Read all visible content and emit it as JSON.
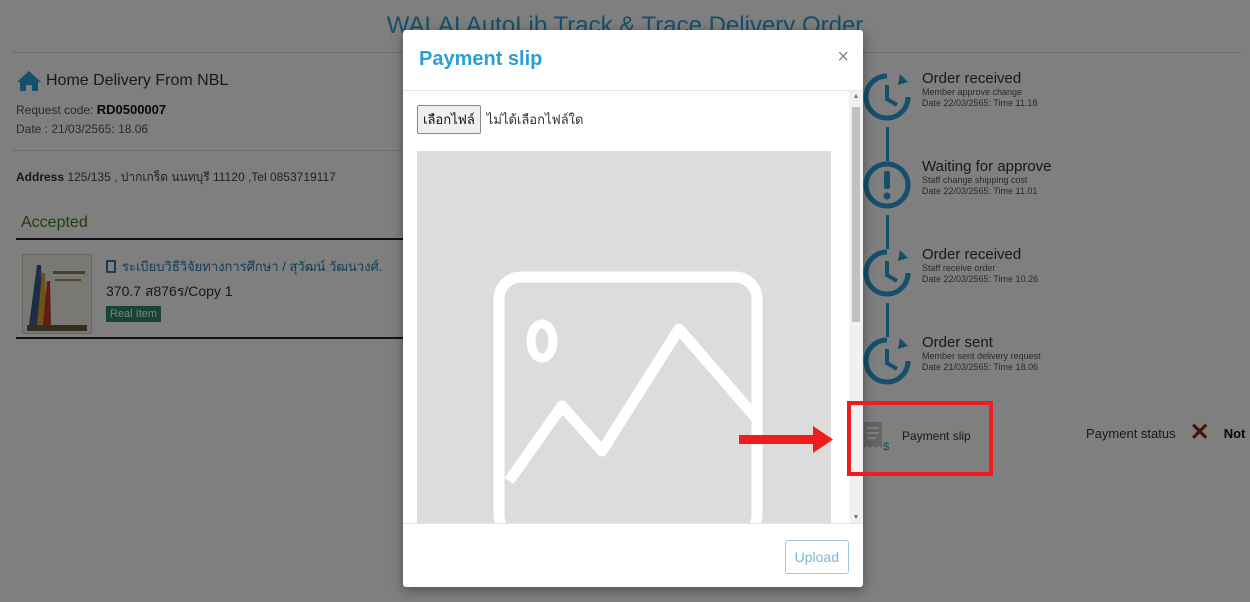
{
  "page": {
    "title": "WALAI AutoLib Track & Trace Delivery Order"
  },
  "order": {
    "home_label": "Home Delivery From NBL",
    "request_code_label": "Request code:",
    "request_code": "RD0500007",
    "date": "Date : 21/03/2565: 18.06",
    "address_label": "Address",
    "address": "125/135 , ปากเกร็ด นนทบุรี 11120 ,Tel 0853719117",
    "status": "Accepted",
    "item": {
      "title": "ระเบียบวิธีวิจัยทางการศึกษา / สุวัฒน์ วัฒนวงศ์.",
      "call_number": "370.7 ส876ร/Copy 1",
      "badge": "Real Item"
    }
  },
  "timeline": [
    {
      "icon": "clock-icon",
      "title": "Order received",
      "line1": "Member approve change",
      "line2": "Date 22/03/2565: Time 11.18"
    },
    {
      "icon": "exclamation-icon",
      "title": "Waiting for approve",
      "line1": "Staff change shipping cost",
      "line2": "Date 22/03/2565: Time 11.01"
    },
    {
      "icon": "clock-icon",
      "title": "Order received",
      "line1": "Staff receive order",
      "line2": "Date 22/03/2565: Time 10.26"
    },
    {
      "icon": "clock-icon",
      "title": "Order sent",
      "line1": "Member sent delivery request",
      "line2": "Date 21/03/2565: Time 18.06"
    }
  ],
  "payment": {
    "slip_label": "Payment slip",
    "status_label": "Payment status",
    "status_value": "Not"
  },
  "modal": {
    "title": "Payment slip",
    "close": "×",
    "file_button": "เลือกไฟล์",
    "file_status": "ไม่ได้เลือกไฟล์ใด",
    "upload_label": "Upload"
  },
  "colors": {
    "accent": "#2a9fd6",
    "accepted": "#3c7d1e",
    "badge": "#2c8a6a",
    "annotation": "#ee1c1c"
  }
}
